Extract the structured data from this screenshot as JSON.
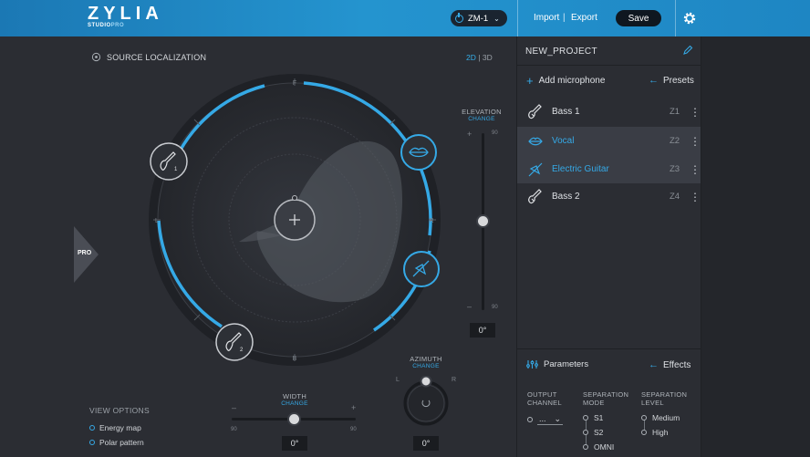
{
  "app": {
    "logo_text": "ZYLIA",
    "logo_sub_1": "STUDIO",
    "logo_sub_2": "PRO",
    "device": "ZM-1",
    "import_label": "Import",
    "separator": "|",
    "export_label": "Export",
    "save_label": "Save"
  },
  "source": {
    "title": "SOURCE LOCALIZATION",
    "mode_2d": "2D",
    "mode_sep": "|",
    "mode_3d": "3D",
    "active_mode": "2D",
    "pro_label": "PRO",
    "compass": {
      "front": "F",
      "back": "B",
      "left": "L",
      "right": "R"
    },
    "sources": [
      {
        "icon": "guitar-icon",
        "sub": "1",
        "active": false
      },
      {
        "icon": "guitar-icon",
        "sub": "2",
        "active": false
      },
      {
        "icon": "lips-icon",
        "active": true
      },
      {
        "icon": "electric-guitar-icon",
        "active": true
      }
    ]
  },
  "elevation": {
    "label": "ELEVATION",
    "change": "CHANGE",
    "max": "90",
    "min": "90",
    "plus": "+",
    "minus": "–",
    "value": "0°"
  },
  "width": {
    "label": "WIDTH",
    "change": "CHANGE",
    "left_val": "90",
    "right_val": "90",
    "minus": "–",
    "plus": "+",
    "value": "0°"
  },
  "azimuth": {
    "label": "AZIMUTH",
    "change": "CHANGE",
    "left": "L",
    "right": "R",
    "value": "0°"
  },
  "view_options": {
    "title": "VIEW OPTIONS",
    "items": [
      "Energy map",
      "Polar pattern"
    ]
  },
  "project": {
    "name": "NEW_PROJECT",
    "add_mic": "Add microphone",
    "presets": "Presets",
    "mics": [
      {
        "name": "Bass 1",
        "zone": "Z1",
        "icon": "guitar-icon",
        "selected": false
      },
      {
        "name": "Vocal",
        "zone": "Z2",
        "icon": "lips-icon",
        "selected": true
      },
      {
        "name": "Electric Guitar",
        "zone": "Z3",
        "icon": "electric-guitar-icon",
        "selected": true
      },
      {
        "name": "Bass 2",
        "zone": "Z4",
        "icon": "guitar-icon",
        "selected": false
      }
    ]
  },
  "parameters": {
    "title": "Parameters",
    "effects": "Effects",
    "output_channel_1": "OUTPUT",
    "output_channel_2": "CHANNEL",
    "output_value": "...",
    "sep_mode_1": "SEPARATION",
    "sep_mode_2": "MODE",
    "sep_modes": [
      "S1",
      "S2",
      "OMNI"
    ],
    "sep_level_1": "SEPARATION",
    "sep_level_2": "LEVEL",
    "sep_levels": [
      "Medium",
      "High"
    ]
  },
  "colors": {
    "accent": "#35a9e6",
    "bg": "#2b2d33",
    "topbar": "#1e86c3"
  }
}
